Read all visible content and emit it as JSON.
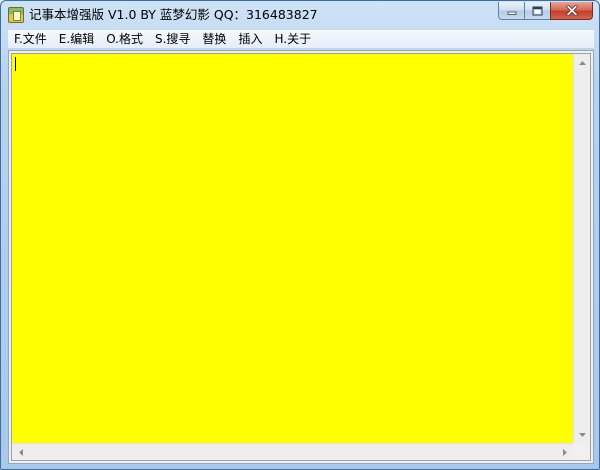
{
  "window": {
    "title": "记事本增强版 V1.0 BY 蓝梦幻影 QQ：316483827",
    "icon": "notepad-app-icon"
  },
  "caption_buttons": {
    "minimize_icon": "minimize-icon",
    "maximize_icon": "maximize-icon",
    "close_icon": "close-icon"
  },
  "menu": {
    "items": [
      {
        "label": "F.文件"
      },
      {
        "label": "E.编辑"
      },
      {
        "label": "O.格式"
      },
      {
        "label": "S.搜寻"
      },
      {
        "label": "替换"
      },
      {
        "label": "插入"
      },
      {
        "label": "H.关于"
      }
    ]
  },
  "editor": {
    "content": "",
    "background_color": "#ffff00"
  },
  "colors": {
    "frame": "#a9c9ea",
    "editor_bg": "#ffff00",
    "close_button": "#c2402a"
  }
}
